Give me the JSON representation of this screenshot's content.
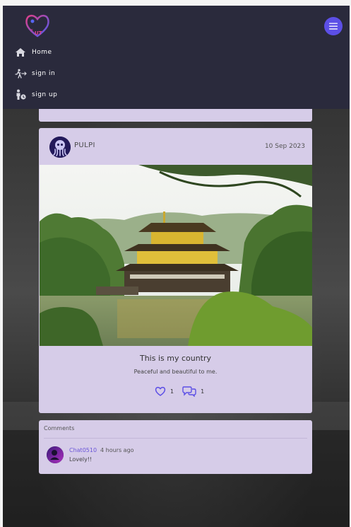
{
  "navbar": {
    "logo_text": "UT",
    "items": [
      {
        "label": "Home",
        "icon": "home-icon"
      },
      {
        "label": "sign in",
        "icon": "sign-in-icon"
      },
      {
        "label": "sign up",
        "icon": "sign-up-icon"
      }
    ],
    "menu_icon": "hamburger-icon"
  },
  "post": {
    "username": "PULPI",
    "date": "10 Sep 2023",
    "title": "This is my country",
    "description": "Peaceful and beautiful to me.",
    "likes": "1",
    "comments_count": "1"
  },
  "comments": {
    "title": "Comments",
    "items": [
      {
        "user": "Chat0510",
        "time": "4 hours ago",
        "text": "Lovely!!"
      }
    ]
  },
  "colors": {
    "navbar_bg": "#2a2a3c",
    "accent": "#5c4fe6",
    "card_bg": "#d6cce8"
  }
}
